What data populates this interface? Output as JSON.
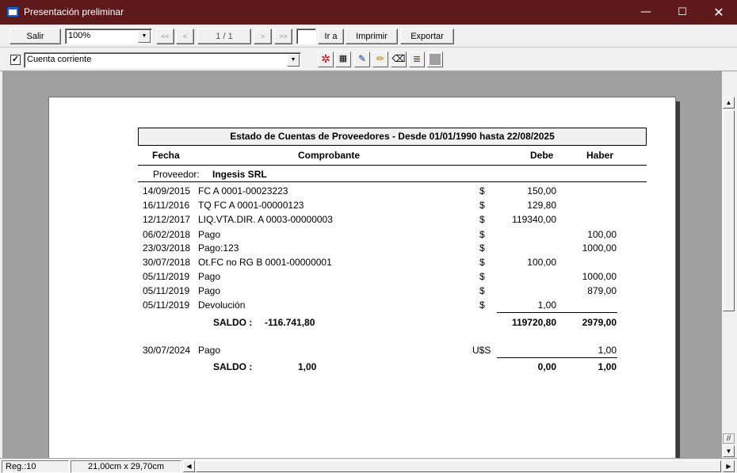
{
  "window": {
    "title": "Presentación preliminar"
  },
  "toolbar": {
    "salir": "Salir",
    "zoom": "100%",
    "first": "<<",
    "prev": "<",
    "page_indicator": "1 / 1",
    "next": ">",
    "last": ">>",
    "goto_value": "",
    "ira": "Ir a",
    "imprimir": "Imprimir",
    "exportar": "Exportar"
  },
  "toolbar2": {
    "checked": "✓",
    "report_select": "Cuenta corriente"
  },
  "report": {
    "title": "Estado de Cuentas de Proveedores - Desde 01/01/1990 hasta 22/08/2025",
    "headers": {
      "fecha": "Fecha",
      "comprobante": "Comprobante",
      "debe": "Debe",
      "haber": "Haber"
    },
    "proveedor_label": "Proveedor:",
    "proveedor_name": "Ingesis SRL",
    "rows": [
      {
        "fecha": "14/09/2015",
        "comprobante": "FC A 0001-00023223",
        "moneda": "$",
        "debe": "150,00",
        "haber": ""
      },
      {
        "fecha": "16/11/2016",
        "comprobante": "TQ FC A 0001-00000123",
        "moneda": "$",
        "debe": "129,80",
        "haber": ""
      },
      {
        "fecha": "12/12/2017",
        "comprobante": "LIQ.VTA.DIR. A 0003-00000003",
        "moneda": "$",
        "debe": "119340,00",
        "haber": ""
      },
      {
        "fecha": "06/02/2018",
        "comprobante": "Pago",
        "moneda": "$",
        "debe": "",
        "haber": "100,00"
      },
      {
        "fecha": "23/03/2018",
        "comprobante": "Pago:123",
        "moneda": "$",
        "debe": "",
        "haber": "1000,00"
      },
      {
        "fecha": "30/07/2018",
        "comprobante": "Ot.FC no RG B 0001-00000001",
        "moneda": "$",
        "debe": "100,00",
        "haber": ""
      },
      {
        "fecha": "05/11/2019",
        "comprobante": "Pago",
        "moneda": "$",
        "debe": "",
        "haber": "1000,00"
      },
      {
        "fecha": "05/11/2019",
        "comprobante": "Pago",
        "moneda": "$",
        "debe": "",
        "haber": "879,00"
      },
      {
        "fecha": "05/11/2019",
        "comprobante": "Devolución",
        "moneda": "$",
        "debe": "1,00",
        "haber": ""
      }
    ],
    "saldo1": {
      "label": "SALDO  :",
      "value": "-116.741,80",
      "debe": "119720,80",
      "haber": "2979,00"
    },
    "usd_row": {
      "fecha": "30/07/2024",
      "comprobante": "Pago",
      "moneda": "U$S",
      "debe": "",
      "haber": "1,00"
    },
    "saldo2": {
      "label": "SALDO  :",
      "value": "1,00",
      "debe": "0,00",
      "haber": "1,00"
    }
  },
  "status": {
    "reg": "Reg.:10",
    "size": "21,00cm x 29,70cm"
  },
  "icons": [
    "settings-icon",
    "page-setup-icon",
    "edit-icon",
    "highlighter-icon",
    "eraser-icon",
    "lines-icon",
    "color-icon"
  ]
}
